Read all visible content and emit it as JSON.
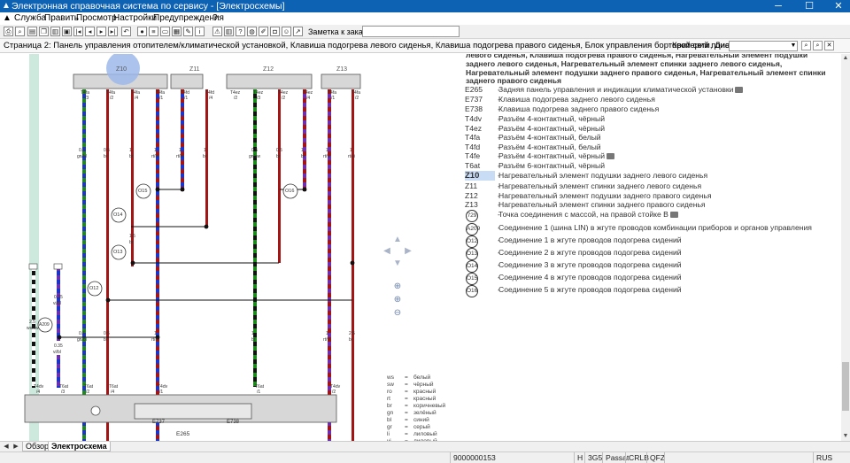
{
  "window": {
    "title": "Электронная справочная система по сервису - [Электросхемы]",
    "controls": {
      "minimize": "─",
      "maximize": "☐",
      "close": "✕"
    }
  },
  "menu": [
    "Служба",
    "Править",
    "Просмотр",
    "Настройки",
    "Предупреждения",
    "?"
  ],
  "toolbar": {
    "note_label": "Заметка к заказу:",
    "note_value": ""
  },
  "searchrow": {
    "page_description": "Страница 2: Панель управления отопителем/климатической установкой, Клавиша подогрева левого сиденья, Клавиша подогрева правого сиденья, Блок управления бортовой сети, Диагностический",
    "criteria_label": "Критерий поиска:",
    "criteria_value": ""
  },
  "legend": {
    "heading": "левого сиденья, Клавиша подогрева правого сиденья, Нагревательный элемент подушки заднего левого сиденья, Нагревательный элемент спинки заднего левого сиденья, Нагревательный элемент подушки заднего правого сиденья, Нагревательный элемент спинки заднего правого сиденья",
    "items": [
      {
        "code": "E265",
        "desc": "Задняя панель управления и индикации климатической установки",
        "camera": true
      },
      {
        "code": "E737",
        "desc": "Клавиша подогрева заднего левого сиденья"
      },
      {
        "code": "E738",
        "desc": "Клавиша подогрева заднего правого сиденья"
      },
      {
        "code": "T4dv",
        "desc": "Разъём 4-контактный, чёрный"
      },
      {
        "code": "T4ez",
        "desc": "Разъём 4-контактный, чёрный"
      },
      {
        "code": "T4fa",
        "desc": "Разъём 4-контактный, белый"
      },
      {
        "code": "T4fd",
        "desc": "Разъём 4-контактный, белый"
      },
      {
        "code": "T4fe",
        "desc": "Разъём 4-контактный, чёрный",
        "camera": true
      },
      {
        "code": "T6at",
        "desc": "Разъём 6-контактный, чёрный"
      },
      {
        "code": "Z10",
        "desc": "Нагревательный элемент подушки заднего левого сиденья",
        "selected": true
      },
      {
        "code": "Z11",
        "desc": "Нагревательный элемент спинки заднего левого сиденья"
      },
      {
        "code": "Z12",
        "desc": "Нагревательный элемент подушки заднего правого сиденья"
      },
      {
        "code": "Z13",
        "desc": "Нагревательный элемент спинки заднего правого сиденья"
      }
    ],
    "circled": [
      {
        "code": "729",
        "desc": "Точка соединения с массой, на правой стойке B",
        "camera": true
      },
      {
        "code": "A209",
        "desc": "Соединение 1 (шина LIN) в жгуте проводов комбинации приборов и органов управления"
      },
      {
        "code": "O12",
        "desc": "Соединение 1 в жгуте проводов подогрева сидений"
      },
      {
        "code": "O13",
        "desc": "Соединение 2 в жгуте проводов подогрева сидений"
      },
      {
        "code": "O14",
        "desc": "Соединение 3 в жгуте проводов подогрева сидений"
      },
      {
        "code": "O15",
        "desc": "Соединение 4 в жгуте проводов подогрева сидений"
      },
      {
        "code": "O16",
        "desc": "Соединение 5 в жгуте проводов подогрева сидений"
      }
    ]
  },
  "color_legend": [
    {
      "k": "ws",
      "v": "белый"
    },
    {
      "k": "sw",
      "v": "чёрный"
    },
    {
      "k": "ro",
      "v": "красный"
    },
    {
      "k": "rt",
      "v": "красный"
    },
    {
      "k": "br",
      "v": "коричневый"
    },
    {
      "k": "gn",
      "v": "зелёный"
    },
    {
      "k": "bl",
      "v": "синий"
    },
    {
      "k": "gr",
      "v": "серый"
    },
    {
      "k": "li",
      "v": "лиловый"
    },
    {
      "k": "vi",
      "v": "лиловый"
    }
  ],
  "diagram": {
    "components": [
      "Z10",
      "Z11",
      "Z12",
      "Z13"
    ],
    "connectors": [
      "T4fa",
      "T4fa",
      "T4fa",
      "T4fa",
      "T4fd",
      "T4fd",
      "T4ez",
      "T4ez",
      "T4ez",
      "T4ez",
      "T4fa",
      "T4fa"
    ],
    "pins": [
      "/3",
      "/2",
      "/4",
      "/1",
      "/1",
      "/4",
      "/2",
      "/3",
      "/2",
      "/4",
      "/1",
      "/2"
    ],
    "wires": [
      "0.5",
      "0.5",
      "1",
      "1",
      "1",
      "1",
      "0.5",
      "0.5",
      "1",
      "1",
      "1"
    ],
    "wire_colors": [
      "gn/bl",
      "br",
      "br",
      "rt/bl",
      "rt/bl",
      "br",
      "gn/sw",
      "br",
      "br",
      "rt/vi",
      "rt/vi"
    ],
    "connections": [
      "O15",
      "O16",
      "O14",
      "O13",
      "O12",
      "A209"
    ],
    "bottom_connectors": [
      "T4dv",
      "T6at",
      "T6at",
      "T6at",
      "T4dv",
      "T6at",
      "T4dv"
    ],
    "bottom_pins": [
      "/4",
      "/3",
      "/2",
      "/4",
      "/1",
      "/1",
      "/2"
    ],
    "wire_values_low": [
      "0.5",
      "0.5",
      "1",
      "1",
      "2.5",
      "1"
    ],
    "wire_colors_low": [
      "gn/bl",
      "br",
      "rt/bl",
      "br",
      "br",
      "rt/vi"
    ],
    "left_wires": [
      "2.5",
      "ws/sw",
      "0.35",
      "vi/bl",
      "0.35",
      "vi/bl"
    ],
    "switch_labels": [
      "E737",
      "E738"
    ],
    "panel_label": "E265",
    "mid_labels": [
      "1.5",
      "br"
    ]
  },
  "tabs": [
    "Обзор",
    "Электросхема"
  ],
  "status": [
    "9000000153",
    "H",
    "3G5",
    "Passat",
    "CRLB",
    "QFZ",
    "RUS"
  ],
  "colors": {
    "titlebar": "#0e62b4",
    "selection": "#c9dcf5",
    "wire_red": "#a31515",
    "wire_blue": "#1a35c9",
    "wire_green": "#1b8a1b",
    "highlight_circle": "#9cb8ea"
  }
}
